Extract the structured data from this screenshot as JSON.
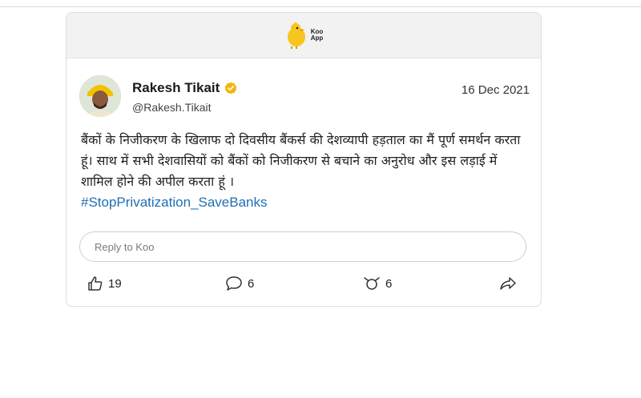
{
  "header": {
    "logo_icon": "koo-bird-icon",
    "logo_line1": "Koo",
    "logo_line2": "App",
    "brand_color": "#f7c51e"
  },
  "post": {
    "author_name": "Rakesh Tikait",
    "verified_icon": "verified-badge-icon",
    "verified_color": "#f2b705",
    "handle": "@Rakesh.Tikait",
    "date": "16 Dec 2021",
    "body_text": "बैंकों के निजीकरण के खिलाफ दो दिवसीय बैंकर्स की देशव्यापी हड़ताल का मैं पूर्ण समर्थन करता हूं। साथ में सभी देशवासियों को बैंकों को निजीकरण से बचाने का अनुरोध और इस लड़ाई में शामिल होने की अपील करता हूं ।",
    "hashtag": "#StopPrivatization_SaveBanks",
    "hashtag_color": "#1f6fb2"
  },
  "reply": {
    "placeholder": "Reply to Koo"
  },
  "actions": {
    "like_icon": "thumbs-up-icon",
    "like_count": "19",
    "comment_icon": "comment-bubble-icon",
    "comment_count": "6",
    "rekoo_icon": "rekoo-icon",
    "rekoo_count": "6",
    "share_icon": "share-arrow-icon"
  }
}
